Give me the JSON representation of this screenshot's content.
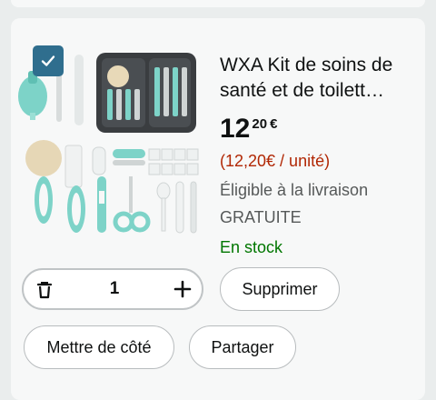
{
  "product": {
    "title": "WXA Kit de soins de santé et de toilett…",
    "price_whole": "12",
    "price_fraction": "20",
    "price_currency": "€",
    "unit_price": "(12,20€ / unité)",
    "shipping_line1": "Éligible à la livraison",
    "shipping_line2": "GRATUITE",
    "stock": "En stock",
    "image_icon": "baby-grooming-kit-image",
    "selected": true
  },
  "controls": {
    "quantity": "1",
    "delete_label": "Supprimer",
    "save_later_label": "Mettre de côté",
    "share_label": "Partager"
  },
  "colors": {
    "accent_teal": "#7dd3c8",
    "checkbox_blue": "#2f6e8e",
    "stock_green": "#007600",
    "unit_price_red": "#b12704"
  }
}
